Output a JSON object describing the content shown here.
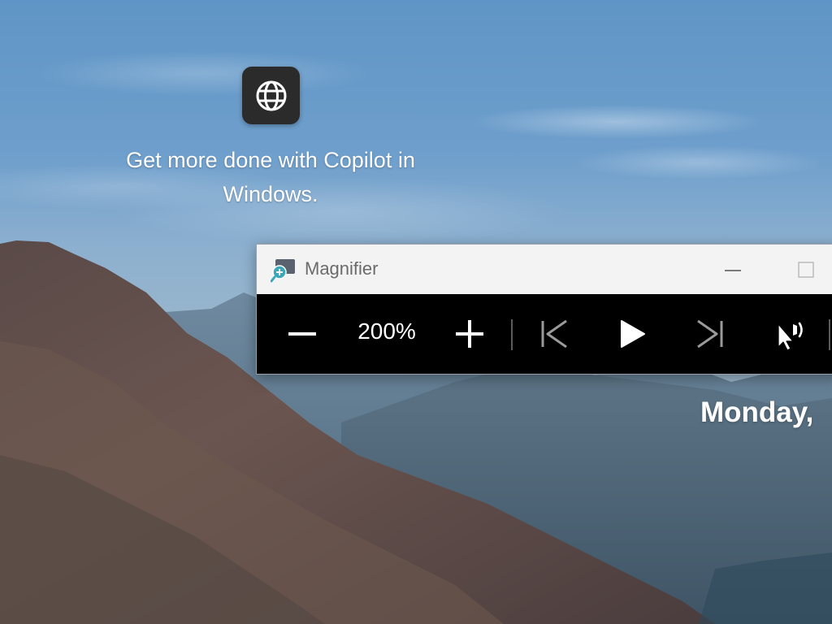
{
  "copilot": {
    "message": "Get more done with Copilot in Windows.",
    "icon": "globe-icon"
  },
  "lockscreen": {
    "date_fragment": "Monday,"
  },
  "magnifier": {
    "title": "Magnifier",
    "app_icon": "magnifier-app-icon",
    "zoom_level": "200%",
    "buttons": {
      "zoom_out": "minus-icon",
      "zoom_in": "plus-icon",
      "previous": "skip-previous-icon",
      "play": "play-icon",
      "next": "skip-next-icon",
      "read_from_here": "read-from-here-icon"
    },
    "titlebar": {
      "minimize": "minimize-icon",
      "maximize": "maximize-icon"
    }
  },
  "colors": {
    "titlebar_bg": "#f3f3f3",
    "toolbar_bg": "#000000",
    "toolbar_fg": "#ffffff",
    "magnifier_accent": "#3aa8b8"
  }
}
